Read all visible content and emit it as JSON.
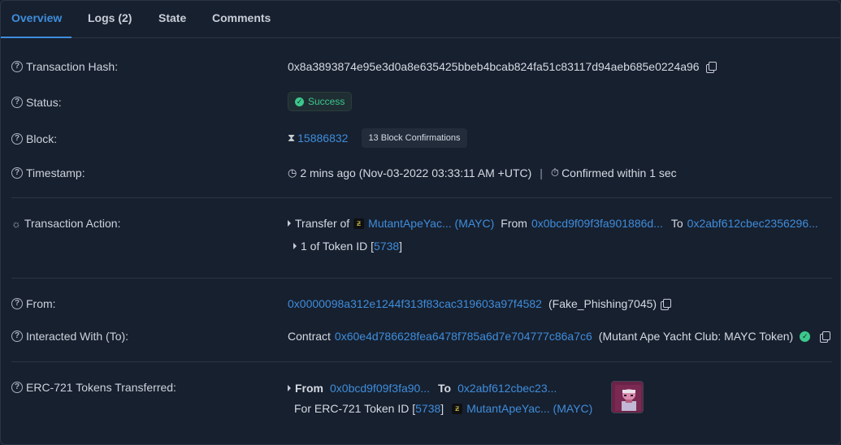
{
  "tabs": [
    {
      "label": "Overview",
      "active": true
    },
    {
      "label": "Logs (2)",
      "active": false
    },
    {
      "label": "State",
      "active": false
    },
    {
      "label": "Comments",
      "active": false
    }
  ],
  "tx_hash": {
    "label": "Transaction Hash:",
    "value": "0x8a3893874e95e3d0a8e635425bbeb4bcab824fa51c83117d94aeb685e0224a96"
  },
  "status": {
    "label": "Status:",
    "value": "Success",
    "color": "#3cc88c"
  },
  "block": {
    "label": "Block:",
    "number": "15886832",
    "confirmations": "13 Block Confirmations"
  },
  "timestamp": {
    "label": "Timestamp:",
    "value": "2 mins ago (Nov-03-2022 03:33:11 AM +UTC)",
    "confirmed": "Confirmed within 1 sec"
  },
  "action": {
    "label": "Transaction Action:",
    "transfer_of": "Transfer of",
    "token": "MutantApeYac... (MAYC)",
    "from_word": "From",
    "from_addr": "0x0bcd9f09f3fa901886d...",
    "to_word": "To",
    "to_addr": "0x2abf612cbec2356296...",
    "qty_text": "1 of Token ID [",
    "token_id": "5738",
    "close_bracket": "]"
  },
  "from": {
    "label": "From:",
    "address": "0x0000098a312e1244f313f83cac319603a97f4582",
    "name": "(Fake_Phishing7045)"
  },
  "interacted": {
    "label": "Interacted With (To):",
    "prefix": "Contract",
    "address": "0x60e4d786628fea6478f785a6d7e704777c86a7c6",
    "name": "(Mutant Ape Yacht Club: MAYC Token)"
  },
  "erc721": {
    "label": "ERC-721 Tokens Transferred:",
    "from_word": "From",
    "from_addr": "0x0bcd9f09f3fa90...",
    "to_word": "To",
    "to_addr": "0x2abf612cbec23...",
    "for_text": "For ERC-721 Token ID [",
    "token_id": "5738",
    "close_bracket": "]",
    "token": "MutantApeYac... (MAYC)"
  },
  "colors": {
    "accent": "#3f8ddb",
    "background": "#17202f",
    "success": "#3cc88c"
  }
}
